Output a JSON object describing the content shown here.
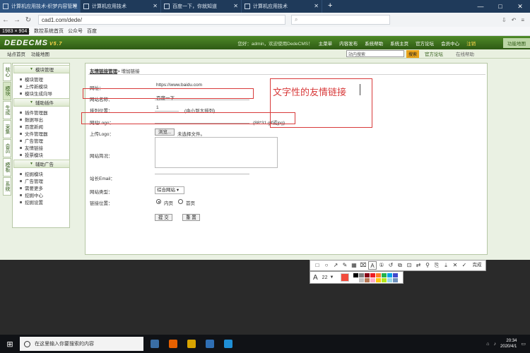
{
  "browser": {
    "tabs": [
      {
        "label": "计算机应用技术-织梦内容管理"
      },
      {
        "label": "计算机应用技术"
      },
      {
        "label": "百度一下，你就知道"
      },
      {
        "label": "计算机应用技术"
      }
    ],
    "new_tab": "+",
    "window_buttons": [
      "—",
      "□",
      "✕"
    ],
    "nav": {
      "back": "←",
      "forward": "→",
      "refresh": "↻"
    },
    "url": "cad1.com/dede/",
    "bookmarks": [
      "网址",
      "数控系统首页",
      "公众号",
      "百度"
    ],
    "size_badge": "1983 × 904"
  },
  "dede": {
    "logo": "DEDECMS",
    "version": "V5.7",
    "welcome": "您好：admin，欢迎使用DedeCMS！",
    "topnav": [
      "主菜单",
      "内容发布",
      "系统帮助",
      "系统主页",
      "官方论坛",
      "会员中心",
      "注销"
    ],
    "top_right": "功能地图",
    "subbar_left": [
      "站点首页",
      "功能地图"
    ],
    "search_placeholder": "站内搜索",
    "search_button": "搜索",
    "links_right": [
      "官方论坛",
      "在线帮助"
    ]
  },
  "vtabs": [
    "核心",
    "模块",
    "生成",
    "采集",
    "会员",
    "模板",
    "系统"
  ],
  "sidemenu": {
    "sections": [
      {
        "title": "模块管理",
        "items": [
          "模块管理",
          "上传新模块",
          "模块生成向导"
        ]
      },
      {
        "title": "辅助插件",
        "items": [
          "插件管理器",
          "数据导出",
          "百度新闻",
          "文件管理器",
          "广告管理",
          "友情链接",
          "投票模块"
        ]
      },
      {
        "title": "辅助广告",
        "items": [
          "挖掘模块",
          "广告管理",
          "需要更多",
          "挖掘中心",
          "挖掘设置"
        ]
      }
    ]
  },
  "form": {
    "breadcrumb_link": "友情链接管理",
    "breadcrumb_rest": "> 增加链接",
    "labels": {
      "url": "网址：",
      "name": "网站名称：",
      "order": "排列位置：",
      "logo": "网站Logo：",
      "upload": "上传Logo：",
      "desc": "网站简况：",
      "email": "站长Email：",
      "type": "网站类型：",
      "position": "链接位置："
    },
    "values": {
      "url": "https://www.baidu.com",
      "name": "百度一下",
      "order": "1",
      "order_hint": "(由小到大排列)",
      "logo_hint": "(88*31 gif或jpg)",
      "browse": "浏览...",
      "no_file": "未选择文件。",
      "type_selected": "综合网站",
      "radio_first": "内页",
      "radio_home": "首页",
      "submit": "提 交",
      "reset": "重 置"
    }
  },
  "annotation": {
    "text": "文字性的友情链接",
    "color": "#d83a3a"
  },
  "toolbar": {
    "done_label": "完成",
    "font_size": "22",
    "current_color": "#f24c3d",
    "palette": [
      "#000000",
      "#7f7f7f",
      "#880015",
      "#ed1c24",
      "#ff7f27",
      "#22b14c",
      "#00a2e8",
      "#3f48cc",
      "#ffffff",
      "#c3c3c3",
      "#b97a57",
      "#ffaec9",
      "#ffc90e",
      "#b5e61d",
      "#99d9ea",
      "#7092be"
    ]
  },
  "taskbar": {
    "search_text": "在这里输入你要搜索的内容",
    "time": "20:34",
    "date": "2020/4/1"
  }
}
